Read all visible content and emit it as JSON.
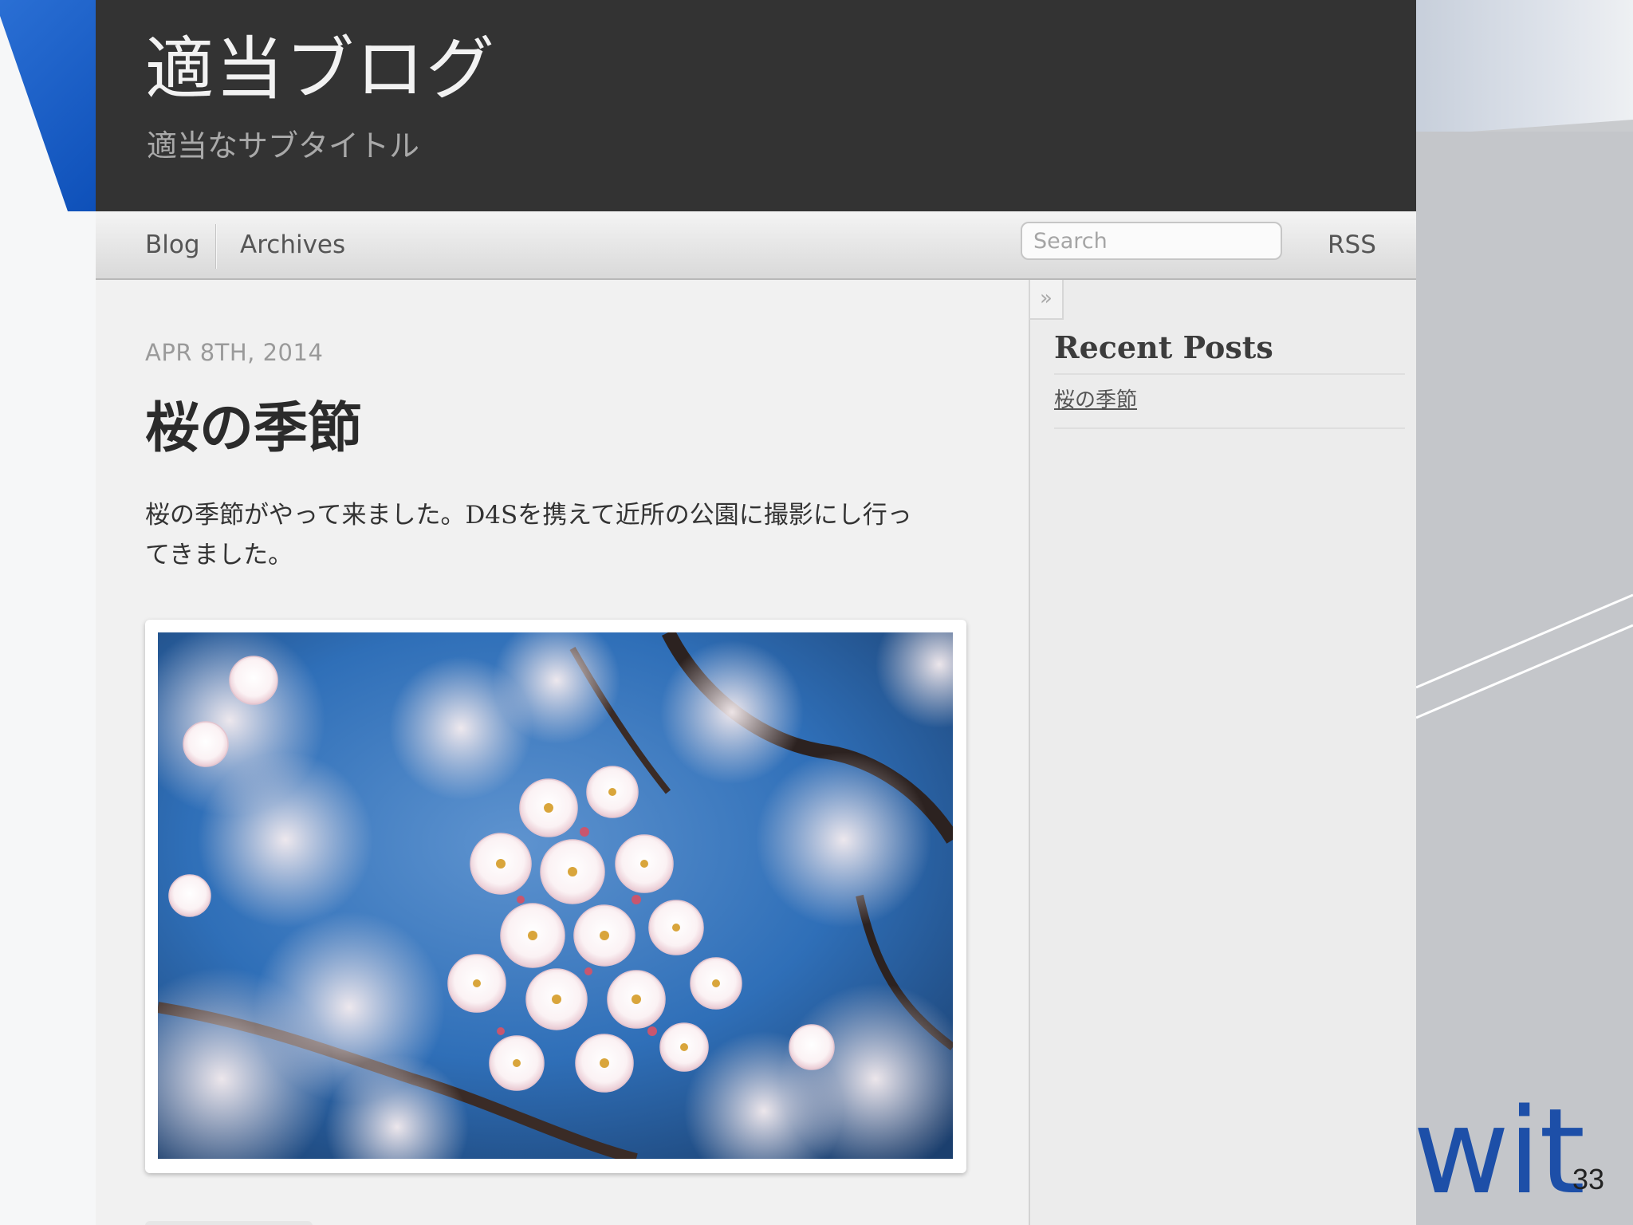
{
  "site": {
    "title": "適当ブログ",
    "subtitle": "適当なサブタイトル"
  },
  "nav": {
    "items": [
      {
        "label": "Blog"
      },
      {
        "label": "Archives"
      }
    ],
    "search": {
      "placeholder": "Search",
      "value": ""
    },
    "rss_label": "RSS"
  },
  "post": {
    "date": "APR 8TH, 2014",
    "title": "桜の季節",
    "body_line1": "桜の季節がやって来ました。D4Sを携えて近所の公園に撮影にし行っ",
    "body_line2": "てきました。",
    "image_subject": "cherry-blossom-photo"
  },
  "sidebar": {
    "collapse_symbol": "»",
    "heading": "Recent Posts",
    "recent_posts": [
      {
        "label": "桜の季節"
      }
    ]
  },
  "slide": {
    "brand_text": "wit",
    "page_number": "33"
  },
  "colors": {
    "header_bg": "#333333",
    "accent_blue": "#1d4fa8",
    "sky_blue": "#2f6fb8",
    "blossom_pink": "#f4dde3"
  }
}
